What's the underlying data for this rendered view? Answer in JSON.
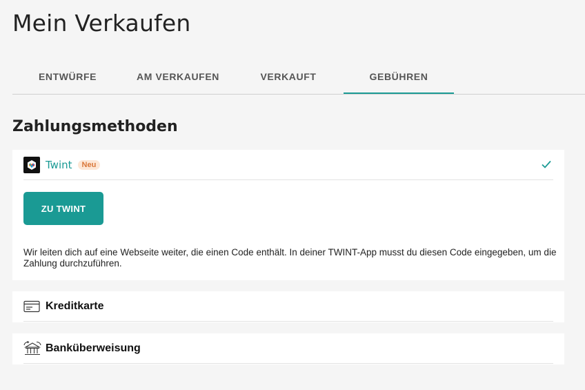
{
  "page": {
    "title": "Mein Verkaufen"
  },
  "tabs": [
    {
      "label": "ENTWÜRFE"
    },
    {
      "label": "AM VERKAUFEN"
    },
    {
      "label": "VERKAUFT"
    },
    {
      "label": "GEBÜHREN"
    }
  ],
  "active_tab": "GEBÜHREN",
  "section": {
    "title": "Zahlungsmethoden"
  },
  "methods": {
    "twint": {
      "name": "Twint",
      "badge": "Neu",
      "button_label": "ZU TWINT",
      "info": "Wir leiten dich auf eine Webseite weiter, die einen Code enthält. In deiner TWINT-App musst du diesen Code eingegeben, um die Zahlung durchzuführen."
    },
    "credit_card": {
      "name": "Kreditkarte"
    },
    "bank_transfer": {
      "name": "Banküberweisung"
    }
  },
  "colors": {
    "accent": "#1a9a94",
    "badge_bg": "#fde7d6",
    "badge_text": "#d9773a"
  }
}
